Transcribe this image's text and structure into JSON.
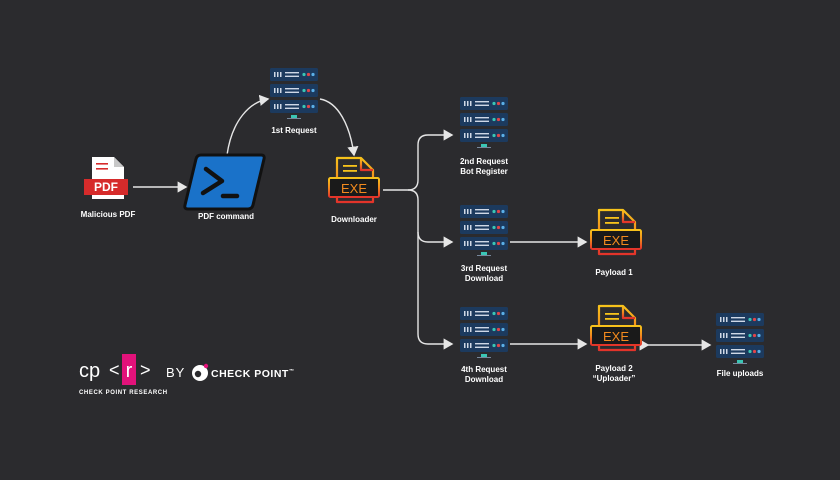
{
  "nodes": {
    "pdf": {
      "icon_text": "PDF",
      "label": "Malicious PDF"
    },
    "powershell": {
      "label": "PDF command"
    },
    "server1": {
      "label": "1st Request"
    },
    "downloader": {
      "icon_text": "EXE",
      "label": "Downloader"
    },
    "server2": {
      "label_line1": "2nd Request",
      "label_line2": "Bot Register"
    },
    "server3": {
      "label_line1": "3rd Request",
      "label_line2": "Download"
    },
    "server4": {
      "label_line1": "4th Request",
      "label_line2": "Download"
    },
    "payload1": {
      "icon_text": "EXE",
      "label": "Payload 1"
    },
    "payload2": {
      "icon_text": "EXE",
      "label_line1": "Payload 2",
      "label_line2": "“Uploader”"
    },
    "uploads": {
      "label": "File uploads"
    }
  },
  "branding": {
    "cpr_left": "cp",
    "cpr_box": "r",
    "cpr_subtitle": "CHECK POINT RESEARCH",
    "by": "BY",
    "checkpoint": "CHECK POINT",
    "trademark": "™"
  },
  "colors": {
    "background": "#2b2b2e",
    "pdf_red": "#d62b2b",
    "powershell_blue": "#1a72c9",
    "server_navy": "#1c3a5e",
    "exe_orange": "#f28a1e",
    "exe_yellow": "#f7c31b",
    "exe_red": "#e3332a",
    "cpr_pink": "#e2127a",
    "line": "#e6e6e6"
  }
}
